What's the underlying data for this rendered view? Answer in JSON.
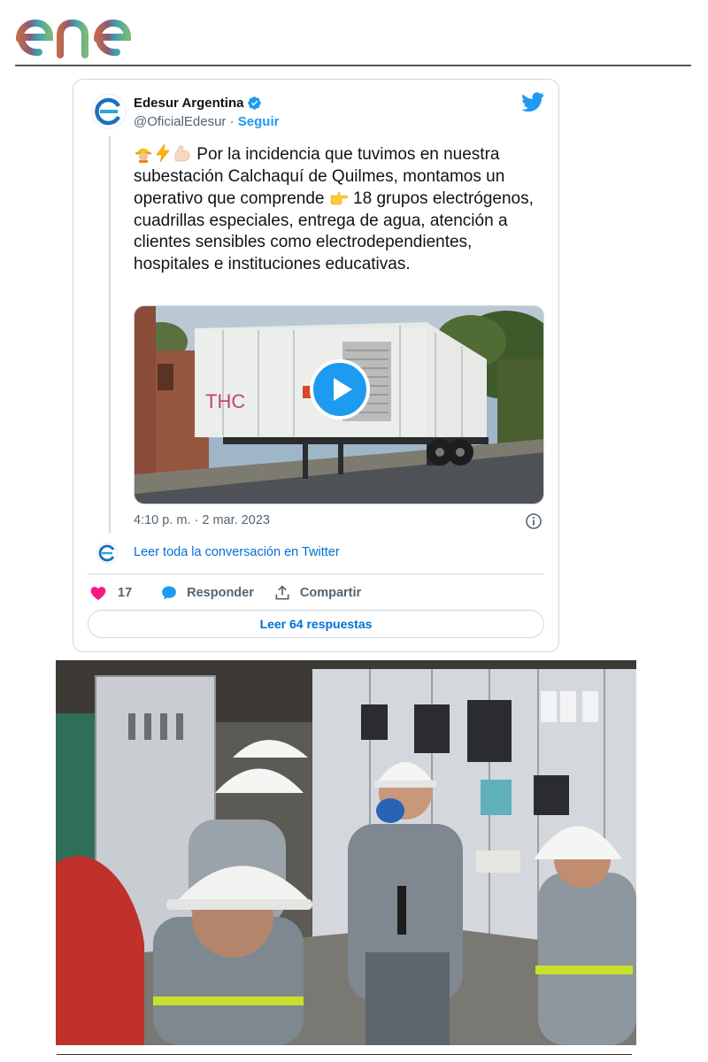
{
  "brand": {
    "logo_text": "enel"
  },
  "tweet": {
    "author_name": "Edesur Argentina",
    "handle": "@OficialEdesur",
    "separator": " · ",
    "follow_label": "Seguir",
    "text_after_emoji": " Por la incidencia que tuvimos en nuestra subestación Calchaquí de Quilmes, montamos un operativo que comprende ",
    "text_end": " 18 grupos electrógenos, cuadrillas especiales, entrega de agua, atención a clientes sensibles como electrodependientes, hospitales e instituciones educativas.",
    "emojis": [
      "construction-worker",
      "high-voltage",
      "flexed-biceps",
      "pointing-right"
    ],
    "timestamp": "4:10 p. m. · 2 mar. 2023",
    "read_conversation": "Leer toda la conversación en Twitter",
    "like_count": "17",
    "reply_label": "Responder",
    "share_label": "Compartir",
    "read_replies_label": "Leer 64 respuestas",
    "media": {
      "type": "video",
      "play_icon": "play-icon"
    }
  },
  "colors": {
    "twitter_blue": "#1d9bf0",
    "link_blue": "#006fd6",
    "like_pink": "#f91880",
    "muted": "#536471",
    "border": "#cfd9de"
  }
}
